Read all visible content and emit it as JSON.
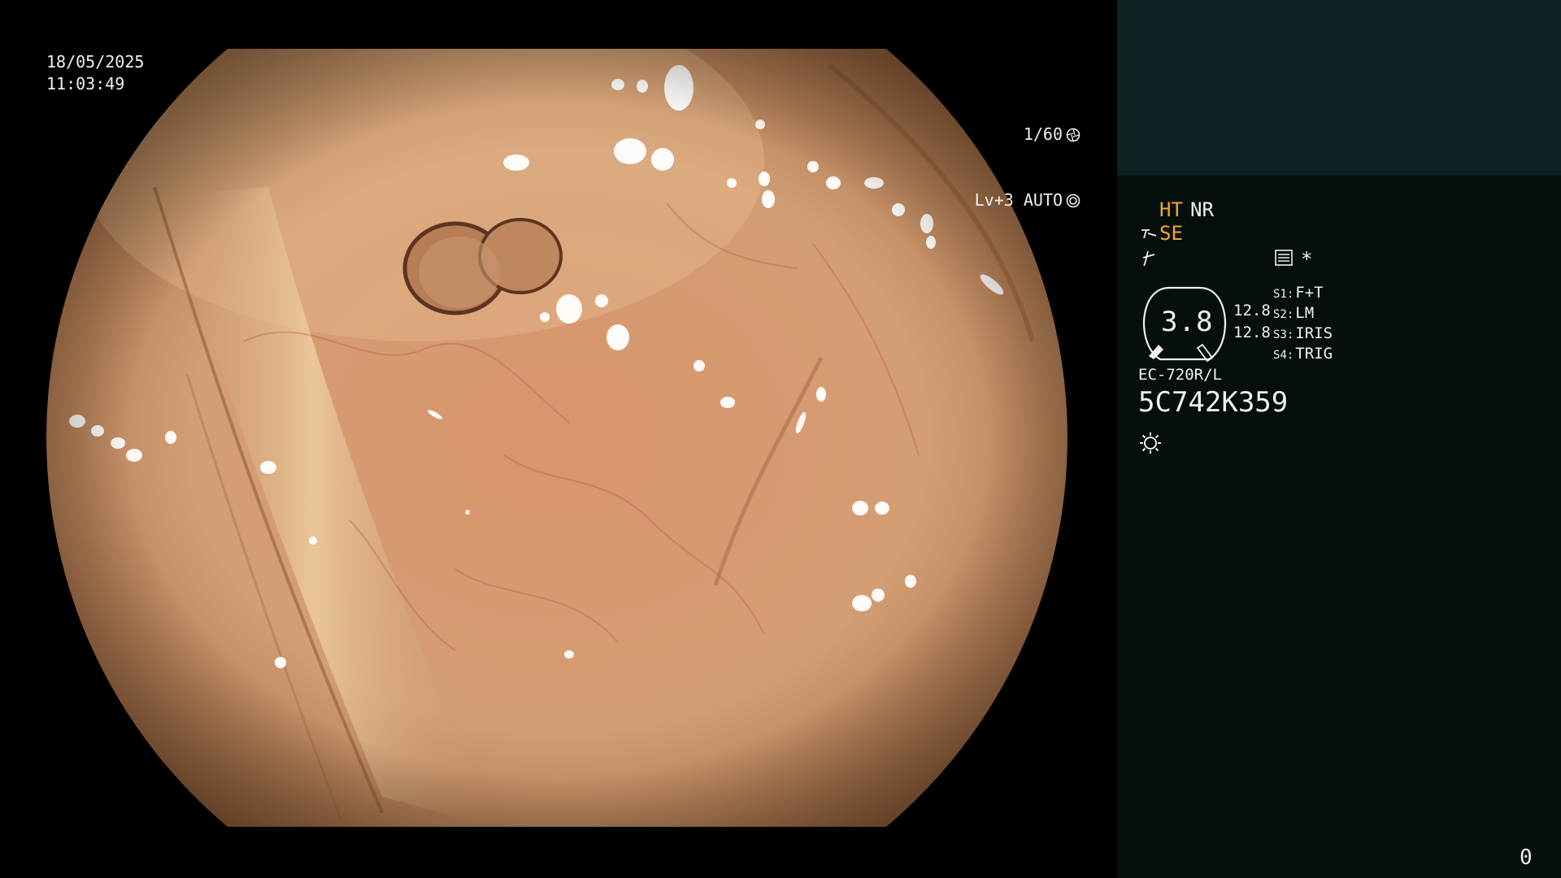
{
  "overlay": {
    "date": "18/05/2025",
    "time": "11:03:49",
    "shutter": "1/60",
    "level": "Lv+3 AUTO"
  },
  "panel": {
    "ht": "HT",
    "nr": "NR",
    "se": "SE",
    "asterisk": "*",
    "gauge_value": "3.8",
    "side_values": [
      "12.8",
      "12.8"
    ],
    "switches": [
      {
        "key": "S1:",
        "value": "F+T"
      },
      {
        "key": "S2:",
        "value": "LM"
      },
      {
        "key": "S3:",
        "value": "IRIS"
      },
      {
        "key": "S4:",
        "value": "TRIG"
      }
    ],
    "scope_model": "EC-720R/L",
    "scope_serial": "5C742K359",
    "counter": "0"
  },
  "icons": {
    "shutter": "aperture-icon",
    "auto": "auto-iris-icon",
    "se": "structure-enhancement-icon",
    "struct": "edge-icon",
    "menu": "menu-icon",
    "light": "light-source-icon"
  },
  "colors": {
    "panel_top": "#0c2223",
    "panel_bottom": "#050f0e",
    "accent_amber": "#f5a623",
    "tissue": "#d9a27a"
  }
}
